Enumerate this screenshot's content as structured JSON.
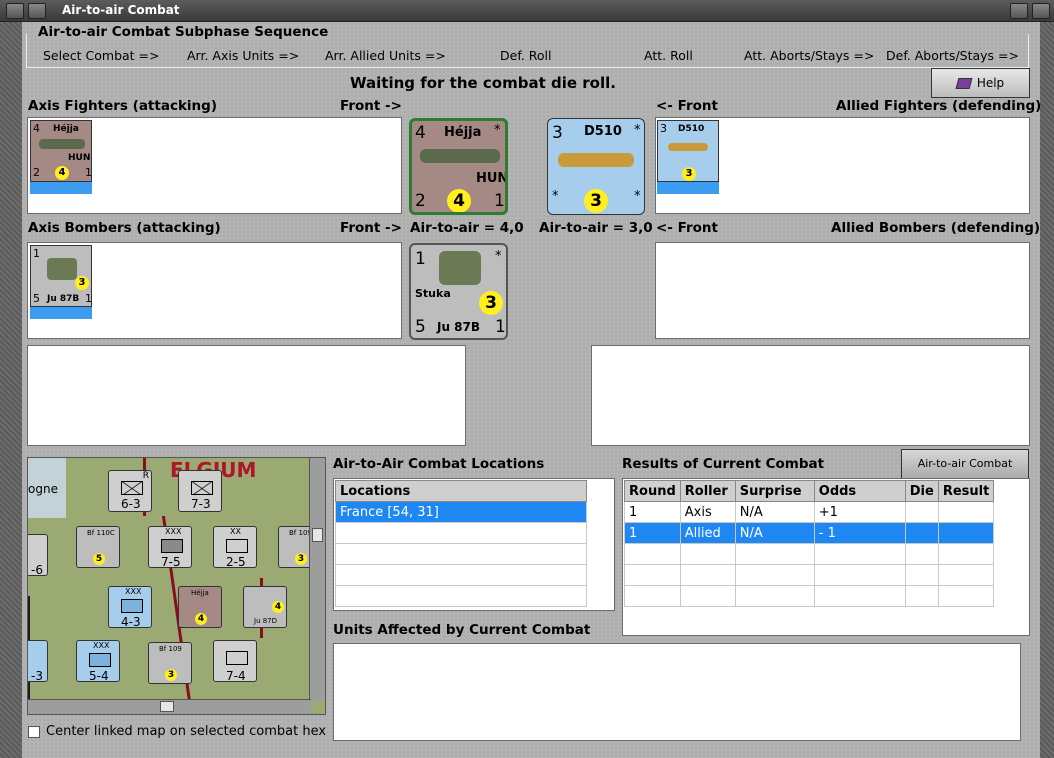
{
  "window": {
    "title": "Air-to-air Combat"
  },
  "sequence": {
    "legend": "Air-to-air Combat Subphase Sequence",
    "steps": [
      "Select Combat =>",
      "Arr. Axis Units =>",
      "Arr. Allied Units =>",
      "Def. Roll",
      "Att. Roll",
      "Att. Aborts/Stays =>",
      "Def. Aborts/Stays =>"
    ]
  },
  "status": "Waiting for the combat die roll.",
  "help_label": "Help",
  "labels": {
    "axis_fighters": "Axis Fighters (attacking)",
    "front_right": "Front ->",
    "front_left": "<- Front",
    "allied_fighters": "Allied Fighters (defending)",
    "axis_bombers": "Axis Bombers (attacking)",
    "front_right2": "Front ->",
    "axis_air": "Air-to-air = 4,0",
    "allied_air": "Air-to-air = 3,0",
    "front_left2": "<- Front",
    "allied_bombers": "Allied Bombers (defending)"
  },
  "units": {
    "hejja": {
      "tl": "4",
      "name": "Héjja",
      "nat": "HUN",
      "bl": "2",
      "val": "4",
      "br": "1",
      "tr": "*"
    },
    "d510": {
      "tl": "3",
      "name": "D510",
      "tr": "*",
      "bl": "*",
      "val": "3",
      "br": "*"
    },
    "stuka": {
      "tl": "1",
      "tr": "*",
      "name": "Stuka",
      "val": "3",
      "bl": "5",
      "type": "Ju 87B",
      "br": "1"
    }
  },
  "locations": {
    "title": "Air-to-Air Combat Locations",
    "header": "Locations",
    "items": [
      "France [54, 31]"
    ]
  },
  "results": {
    "title": "Results of Current Combat",
    "chart_button": "Air-to-air Combat Chart",
    "columns": [
      "Round",
      "Roller",
      "Surprise",
      "Odds",
      "Die",
      "Result"
    ],
    "rows": [
      [
        "1",
        "Axis",
        "N/A",
        "+1",
        "",
        ""
      ],
      [
        "1",
        "Allied",
        "N/A",
        "- 1",
        "",
        ""
      ]
    ]
  },
  "units_affected": {
    "title": "Units Affected by Current Combat"
  },
  "center_map": {
    "label": "Center linked map on selected combat hex"
  },
  "map": {
    "labels": [
      "ELGIUM",
      "ogne"
    ],
    "counters": [
      {
        "top": "R",
        "val": "6-3"
      },
      {
        "top": "",
        "val": "7-3"
      },
      {
        "top": "XXX",
        "val": "7-5"
      },
      {
        "top": "XX",
        "val": "2-5"
      },
      {
        "top": "XXX",
        "val": "4-3"
      },
      {
        "top": "XXX",
        "val": "5-4"
      },
      {
        "top": "",
        "val": "7-4"
      },
      {
        "top": "",
        "val": "-6"
      },
      {
        "top": "",
        "val": "-3"
      }
    ],
    "air": [
      {
        "name": "Bf 110C",
        "val": "5"
      },
      {
        "name": "Bf 109",
        "val": "3"
      },
      {
        "name": "Héjja",
        "val": "4"
      },
      {
        "name": "Ju 87D",
        "val": "4"
      },
      {
        "name": "Bf 109",
        "val": "3"
      }
    ]
  },
  "colors": {
    "panel_bg": "#b3b3b3",
    "selection": "#1f87f2",
    "hun_counter": "#a58985",
    "fr_counter": "#a7cdec",
    "token": "#ffef1f"
  }
}
